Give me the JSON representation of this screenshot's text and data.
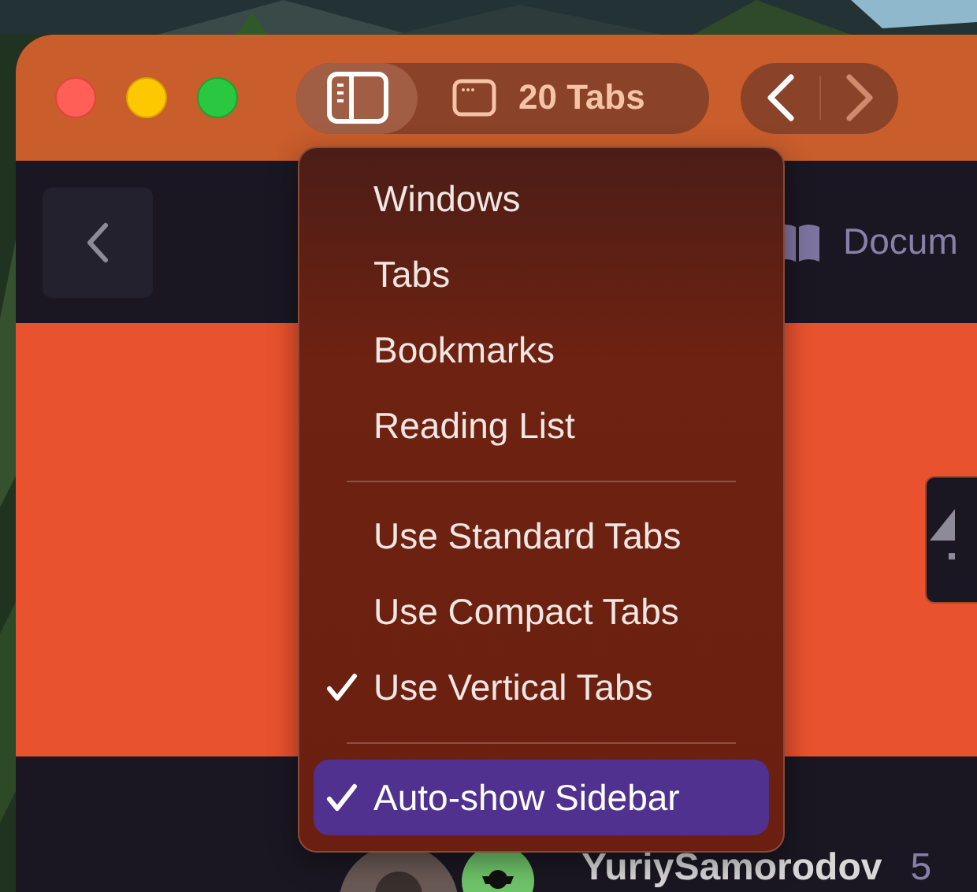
{
  "toolbar": {
    "sidebar_button": {
      "selected": true
    },
    "tabs_button": {
      "label": "20 Tabs"
    },
    "back_button": {
      "disabled": false
    },
    "forward_button": {
      "disabled": true
    }
  },
  "navbar": {
    "docs_link": {
      "label": "Docum"
    }
  },
  "menu": {
    "sections": [
      {
        "items": [
          {
            "label": "Windows",
            "checked": false,
            "selected": false
          },
          {
            "label": "Tabs",
            "checked": false,
            "selected": false
          },
          {
            "label": "Bookmarks",
            "checked": false,
            "selected": false
          },
          {
            "label": "Reading List",
            "checked": false,
            "selected": false
          }
        ]
      },
      {
        "items": [
          {
            "label": "Use Standard Tabs",
            "checked": false,
            "selected": false
          },
          {
            "label": "Use Compact Tabs",
            "checked": false,
            "selected": false
          },
          {
            "label": "Use Vertical Tabs",
            "checked": true,
            "selected": false
          }
        ]
      },
      {
        "items": [
          {
            "label": "Auto-show Sidebar",
            "checked": true,
            "selected": true
          }
        ]
      }
    ]
  },
  "user": {
    "name": "YuriySamorodov",
    "count": "5"
  }
}
